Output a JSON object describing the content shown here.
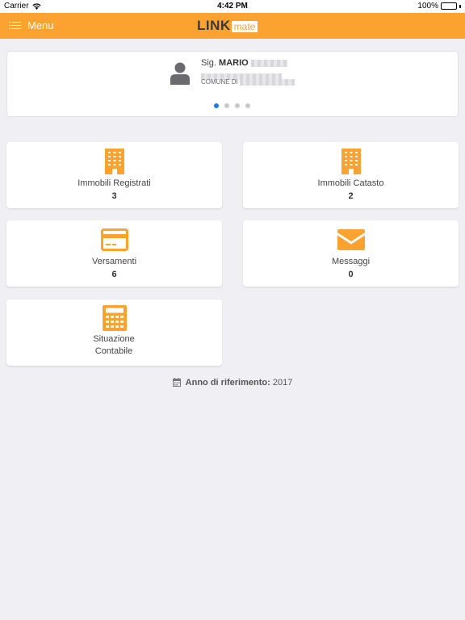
{
  "status_bar": {
    "carrier": "Carrier",
    "time": "4:42 PM",
    "battery": "100%"
  },
  "navbar": {
    "menu_label": "Menu",
    "logo_primary": "LINK",
    "logo_secondary": "mate"
  },
  "user": {
    "salutation": "Sig.",
    "name": "MARIO",
    "comune_prefix": "COMUNE DI",
    "pager": {
      "pages": 4,
      "active": 1
    }
  },
  "tiles": [
    {
      "label": "Immobili Registrati",
      "count": "3",
      "icon": "building-icon"
    },
    {
      "label": "Immobili Catasto",
      "count": "2",
      "icon": "building-icon"
    },
    {
      "label": "Versamenti",
      "count": "6",
      "icon": "credit-card-icon"
    },
    {
      "label": "Messaggi",
      "count": "0",
      "icon": "envelope-icon"
    },
    {
      "label": "Situazione Contabile",
      "count": "",
      "icon": "calculator-icon"
    }
  ],
  "reference": {
    "label": "Anno di riferimento:",
    "year": "2017"
  },
  "colors": {
    "accent": "#fba231",
    "pager_active": "#1f7ae0",
    "background": "#f0f0f4"
  }
}
